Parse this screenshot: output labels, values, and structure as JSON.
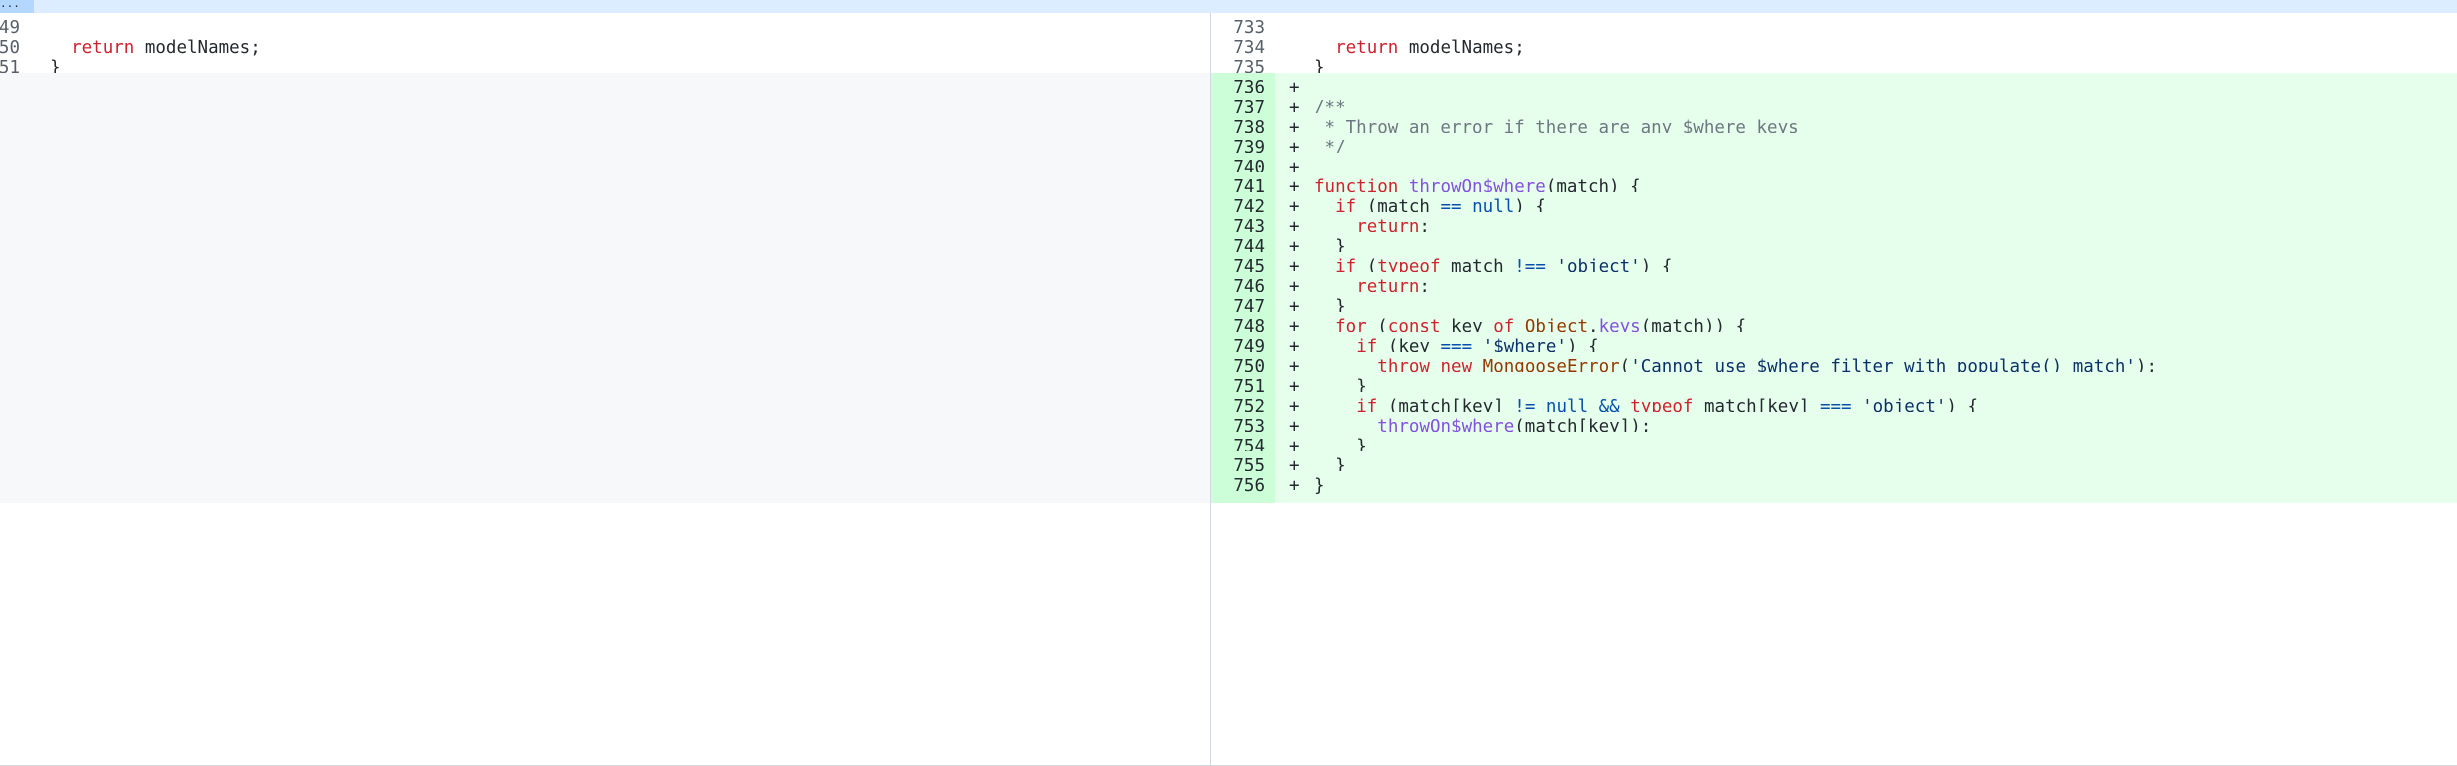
{
  "hunk": {
    "expand_label": "..."
  },
  "left_lines": [
    {
      "num": "49",
      "code": ""
    },
    {
      "num": "50",
      "code": "  return modelNames;"
    },
    {
      "num": "51",
      "code": "}"
    }
  ],
  "right_lines": [
    {
      "num": "733",
      "marker": "",
      "code": ""
    },
    {
      "num": "734",
      "marker": "",
      "code": "  return modelNames;"
    },
    {
      "num": "735",
      "marker": "",
      "code": "}"
    },
    {
      "num": "736",
      "marker": "+",
      "code": ""
    },
    {
      "num": "737",
      "marker": "+",
      "code": "/**"
    },
    {
      "num": "738",
      "marker": "+",
      "code": " * Throw an error if there are any $where keys"
    },
    {
      "num": "739",
      "marker": "+",
      "code": " */"
    },
    {
      "num": "740",
      "marker": "+",
      "code": ""
    },
    {
      "num": "741",
      "marker": "+",
      "code": "function throwOn$where(match) {"
    },
    {
      "num": "742",
      "marker": "+",
      "code": "  if (match == null) {"
    },
    {
      "num": "743",
      "marker": "+",
      "code": "    return;"
    },
    {
      "num": "744",
      "marker": "+",
      "code": "  }"
    },
    {
      "num": "745",
      "marker": "+",
      "code": "  if (typeof match !== 'object') {"
    },
    {
      "num": "746",
      "marker": "+",
      "code": "    return;"
    },
    {
      "num": "747",
      "marker": "+",
      "code": "  }"
    },
    {
      "num": "748",
      "marker": "+",
      "code": "  for (const key of Object.keys(match)) {"
    },
    {
      "num": "749",
      "marker": "+",
      "code": "    if (key === '$where') {"
    },
    {
      "num": "750",
      "marker": "+",
      "code": "      throw new MongooseError('Cannot use $where filter with populate() match');"
    },
    {
      "num": "751",
      "marker": "+",
      "code": "    }"
    },
    {
      "num": "752",
      "marker": "+",
      "code": "    if (match[key] != null && typeof match[key] === 'object') {"
    },
    {
      "num": "753",
      "marker": "+",
      "code": "      throwOn$where(match[key]);"
    },
    {
      "num": "754",
      "marker": "+",
      "code": "    }"
    },
    {
      "num": "755",
      "marker": "+",
      "code": "  }"
    },
    {
      "num": "756",
      "marker": "+",
      "code": "}"
    }
  ],
  "colors": {
    "added_bg": "#e6ffec",
    "added_gutter": "#ccffd8",
    "empty_bg": "#f6f8fa",
    "hunk_bg": "#dbedff",
    "keyword": "#cf222e",
    "function": "#8250df",
    "comment": "#6e7781",
    "string": "#0a3069"
  }
}
